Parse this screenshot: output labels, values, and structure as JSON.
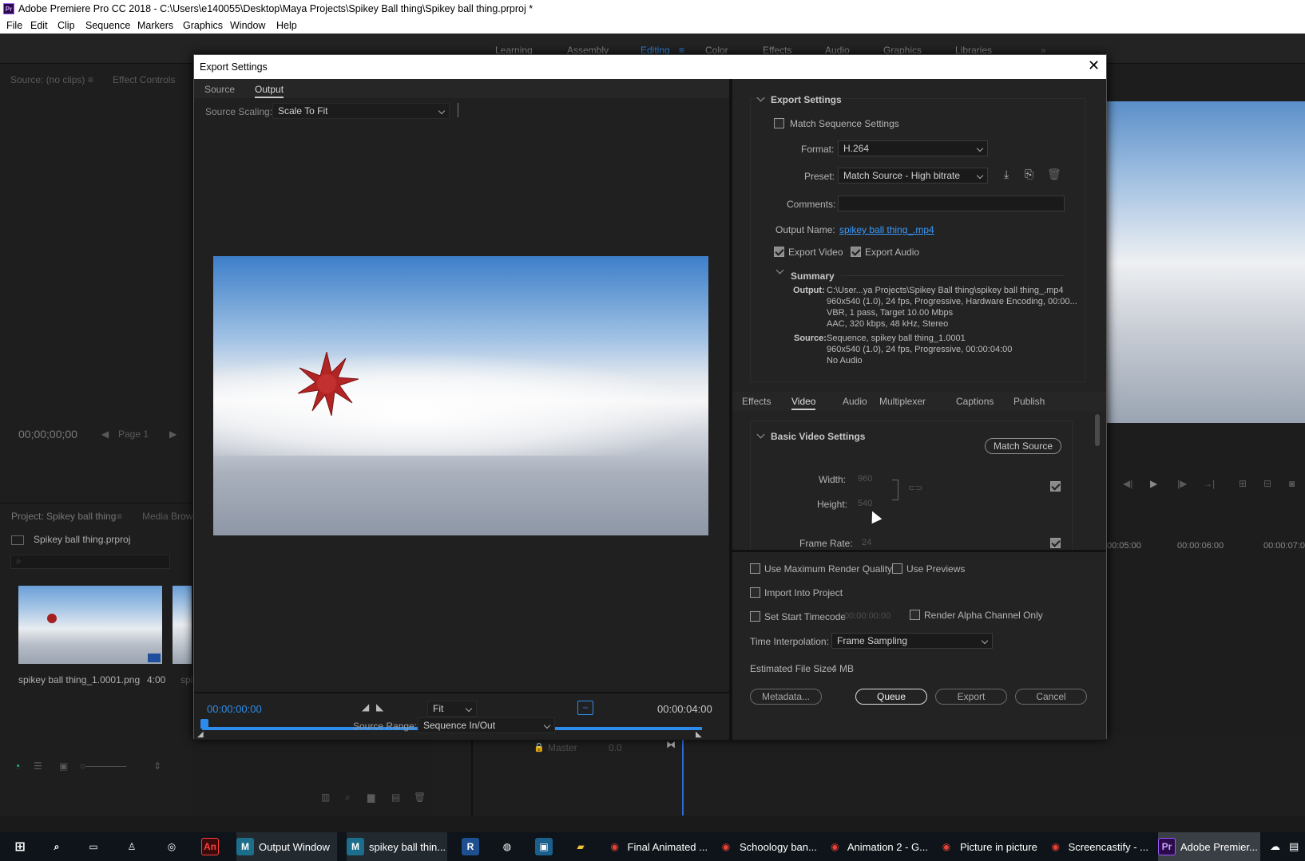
{
  "window": {
    "app_logo": "Pr",
    "title": "Adobe Premiere Pro CC 2018 - C:\\Users\\e140055\\Desktop\\Maya Projects\\Spikey Ball thing\\Spikey ball thing.prproj *"
  },
  "menu": [
    "File",
    "Edit",
    "Clip",
    "Sequence",
    "Markers",
    "Graphics",
    "Window",
    "Help"
  ],
  "workspaces": [
    {
      "label": "Learning"
    },
    {
      "label": "Assembly"
    },
    {
      "label": "Editing",
      "active": true
    },
    {
      "label": "Color"
    },
    {
      "label": "Effects"
    },
    {
      "label": "Audio"
    },
    {
      "label": "Graphics"
    },
    {
      "label": "Libraries"
    }
  ],
  "workspace_overflow": "»",
  "source_panel": {
    "tab_source": "Source: (no clips)",
    "tab_effect_controls": "Effect Controls",
    "timecode": "00;00;00;00",
    "page": "Page 1"
  },
  "project_panel": {
    "tab_project": "Project: Spikey ball thing",
    "tab_media": "Media Brow",
    "project_file": "Spikey ball thing.prproj",
    "clip_name": "spikey ball thing_1.0001.png",
    "clip_duration": "4:00",
    "clip2_name": "spi"
  },
  "timeline": {
    "ruler_5": "00:05:00",
    "ruler_6": "00:00:06:00",
    "ruler_7": "00:00:07:0",
    "master_label": "Master",
    "master_value": "0.0"
  },
  "dialog": {
    "title": "Export Settings",
    "tabs": {
      "source": "Source",
      "output": "Output"
    },
    "source_scaling_label": "Source Scaling:",
    "source_scaling_value": "Scale To Fit",
    "current_time": "00:00:00:00",
    "duration": "00:00:04:00",
    "fit": "Fit",
    "source_range_label": "Source Range:",
    "source_range_value": "Sequence In/Out",
    "export_settings": {
      "section": "Export Settings",
      "match_sequence": "Match Sequence Settings",
      "format_label": "Format:",
      "format_value": "H.264",
      "preset_label": "Preset:",
      "preset_value": "Match Source - High bitrate",
      "comments_label": "Comments:",
      "comments_value": "",
      "output_name_label": "Output Name:",
      "output_name_value": "spikey ball thing_.mp4",
      "export_video": "Export Video",
      "export_audio": "Export Audio",
      "summary": "Summary",
      "output_key": "Output:",
      "output_lines": [
        "C:\\User...ya Projects\\Spikey Ball thing\\spikey ball thing_.mp4",
        "960x540 (1.0), 24 fps, Progressive, Hardware Encoding, 00:00...",
        "VBR, 1 pass, Target 10.00 Mbps",
        "AAC, 320 kbps, 48 kHz, Stereo"
      ],
      "source_key": "Source:",
      "source_lines": [
        "Sequence, spikey ball thing_1.0001",
        "960x540 (1.0), 24 fps, Progressive, 00:00:04:00",
        "No Audio"
      ]
    },
    "settings_tabs": [
      "Effects",
      "Video",
      "Audio",
      "Multiplexer",
      "Captions",
      "Publish"
    ],
    "active_settings_tab": "Video",
    "video": {
      "section": "Basic Video Settings",
      "match_source": "Match Source",
      "width_label": "Width:",
      "width_value": "960",
      "height_label": "Height:",
      "height_value": "540",
      "frame_rate_label": "Frame Rate:",
      "frame_rate_value": "24"
    },
    "bottom": {
      "max_render": "Use Maximum Render Quality",
      "use_previews": "Use Previews",
      "import_project": "Import Into Project",
      "start_timecode": "Set Start Timecode",
      "start_timecode_value": "00:00:00:00",
      "render_alpha": "Render Alpha Channel Only",
      "time_interp_label": "Time Interpolation:",
      "time_interp_value": "Frame Sampling",
      "file_size_label": "Estimated File Size:",
      "file_size_value": "4 MB",
      "metadata": "Metadata...",
      "queue": "Queue",
      "export": "Export",
      "cancel": "Cancel"
    }
  },
  "taskbar": [
    {
      "label": "",
      "icon": "maya-icon"
    },
    {
      "label": "Output Window",
      "icon": "maya-icon"
    },
    {
      "label": "spikey ball thin...",
      "icon": "maya-icon"
    },
    {
      "label": "Final Animated ...",
      "icon": "chrome-icon"
    },
    {
      "label": "Schoology ban...",
      "icon": "chrome-icon"
    },
    {
      "label": "Animation 2 - G...",
      "icon": "chrome-icon"
    },
    {
      "label": "Picture in picture",
      "icon": "chrome-icon"
    },
    {
      "label": "Screencastify - ...",
      "icon": "chrome-icon"
    },
    {
      "label": "Adobe Premier...",
      "icon": "premiere-icon"
    }
  ],
  "colors": {
    "accent": "#2d8ceb",
    "link": "#3a9bff",
    "dialog_bg": "#232323"
  }
}
